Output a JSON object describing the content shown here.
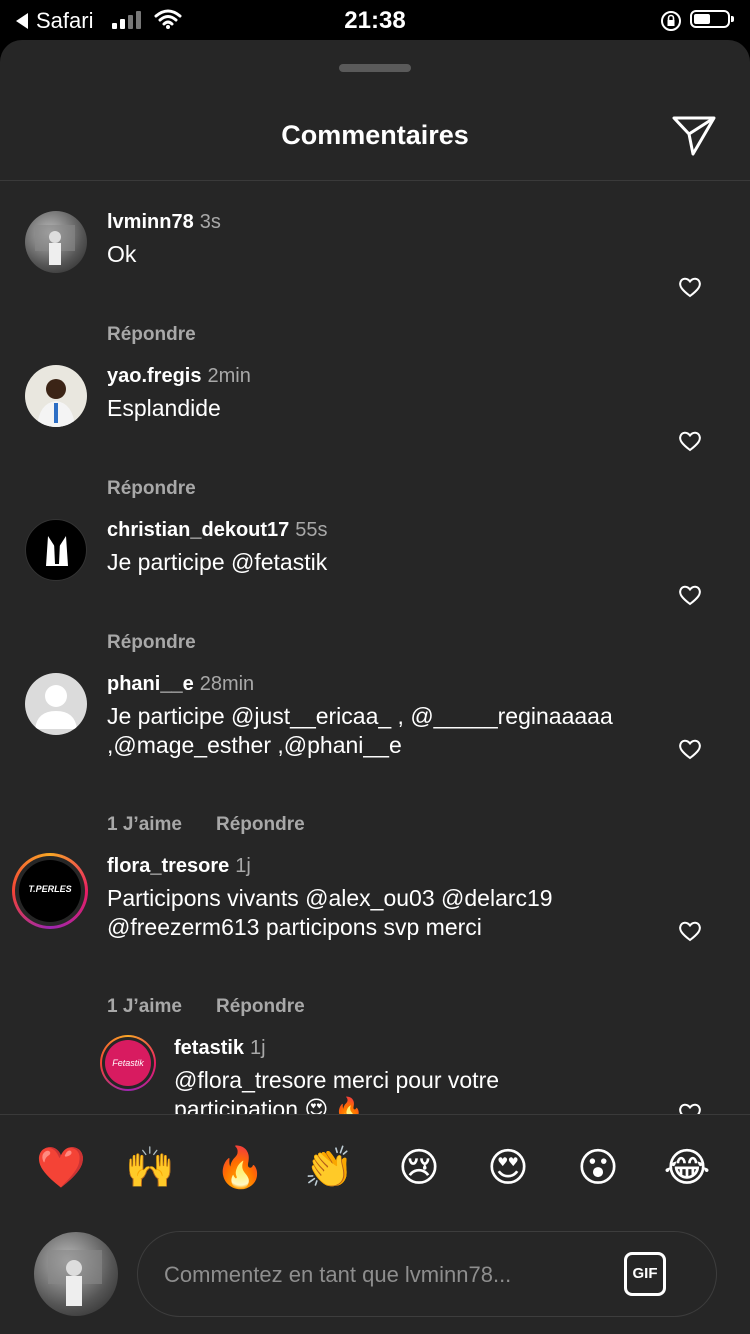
{
  "status_bar": {
    "back_label": "Safari",
    "time": "21:38"
  },
  "header": {
    "title": "Commentaires"
  },
  "comments": [
    {
      "username": "lvminn78",
      "time": "3s",
      "text_lines": [
        "Ok"
      ],
      "likes": "",
      "reply": "Répondre"
    },
    {
      "username": "yao.fregis",
      "time": "2min",
      "text_lines": [
        "Esplandide"
      ],
      "likes": "",
      "reply": "Répondre"
    },
    {
      "username": "christian_dekout17",
      "time": "55s",
      "text_lines": [
        "Je participe @fetastik"
      ],
      "likes": "",
      "reply": "Répondre"
    },
    {
      "username": "phani__e",
      "time": "28min",
      "text_lines": [
        "Je participe @just__ericaa_ , @_____reginaaaaa",
        ",@mage_esther ,@phani__e"
      ],
      "likes": "1 J’aime",
      "reply": "Répondre"
    },
    {
      "username": "flora_tresore",
      "time": "1j",
      "avatar_label": "T.PERLES",
      "text_lines": [
        "Participons vivants @alex_ou03  @delarc19",
        "@freezerm613  participons svp merci"
      ],
      "likes": "1 J’aime",
      "reply": "Répondre"
    },
    {
      "username": "fetastik",
      "time": "1j",
      "avatar_label": "Fetastik",
      "text_lines": [
        "@flora_tresore merci pour votre",
        "participation 😍 🔥"
      ],
      "likes": "",
      "reply": ""
    }
  ],
  "emoji_bar": [
    "❤️",
    "🙌",
    "🔥",
    "👏",
    "😢",
    "😍",
    "😮",
    "😂"
  ],
  "composer": {
    "placeholder": "Commentez en tant que lvminn78...",
    "gif_label": "GIF"
  }
}
